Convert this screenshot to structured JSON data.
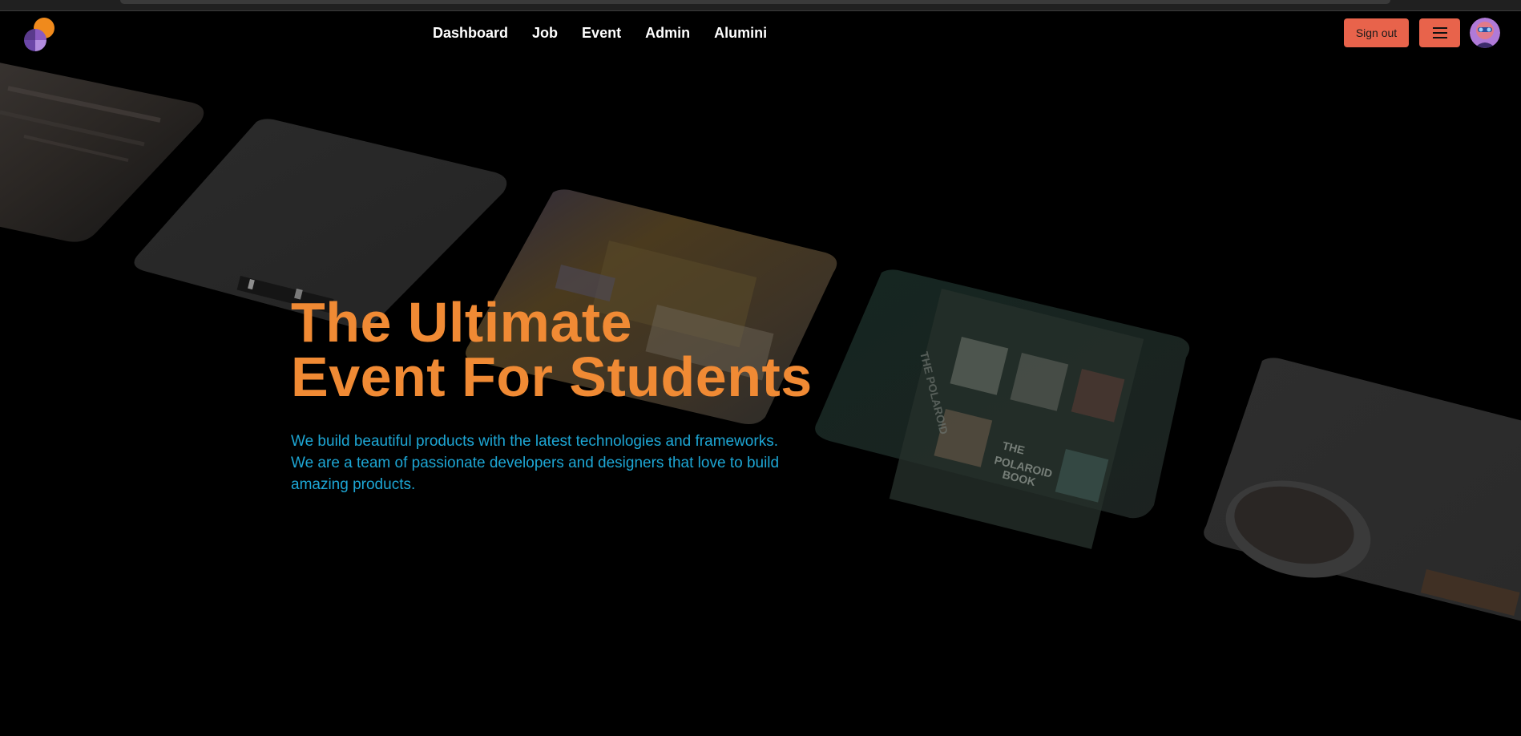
{
  "navbar": {
    "links": [
      {
        "label": "Dashboard"
      },
      {
        "label": "Job"
      },
      {
        "label": "Event"
      },
      {
        "label": "Admin"
      },
      {
        "label": "Alumini"
      }
    ],
    "signout_label": "Sign out",
    "menu_icon": "hamburger-icon",
    "avatar_icon": "user-avatar",
    "logo_icon": "app-logo"
  },
  "hero": {
    "title_line1": "The Ultimate",
    "title_line2": "Event For Students",
    "description": "We build beautiful products with the latest technologies and frameworks. We are a team of passionate developers and designers that love to build amazing products."
  },
  "gallery": {
    "images": [
      {
        "name": "gallery-image-1",
        "subject": "blurred window light"
      },
      {
        "name": "gallery-image-2",
        "subject": "desk with notebook"
      },
      {
        "name": "gallery-image-3",
        "subject": "stacked papers and books"
      },
      {
        "name": "gallery-image-4",
        "subject": "The Polaroid Book"
      },
      {
        "name": "gallery-image-5",
        "subject": "coffee cup on table"
      }
    ]
  },
  "colors": {
    "background": "#000000",
    "accent_button": "#e8634b",
    "title": "#f08a34",
    "description": "#1da6d4",
    "nav_text": "#ffffff"
  }
}
